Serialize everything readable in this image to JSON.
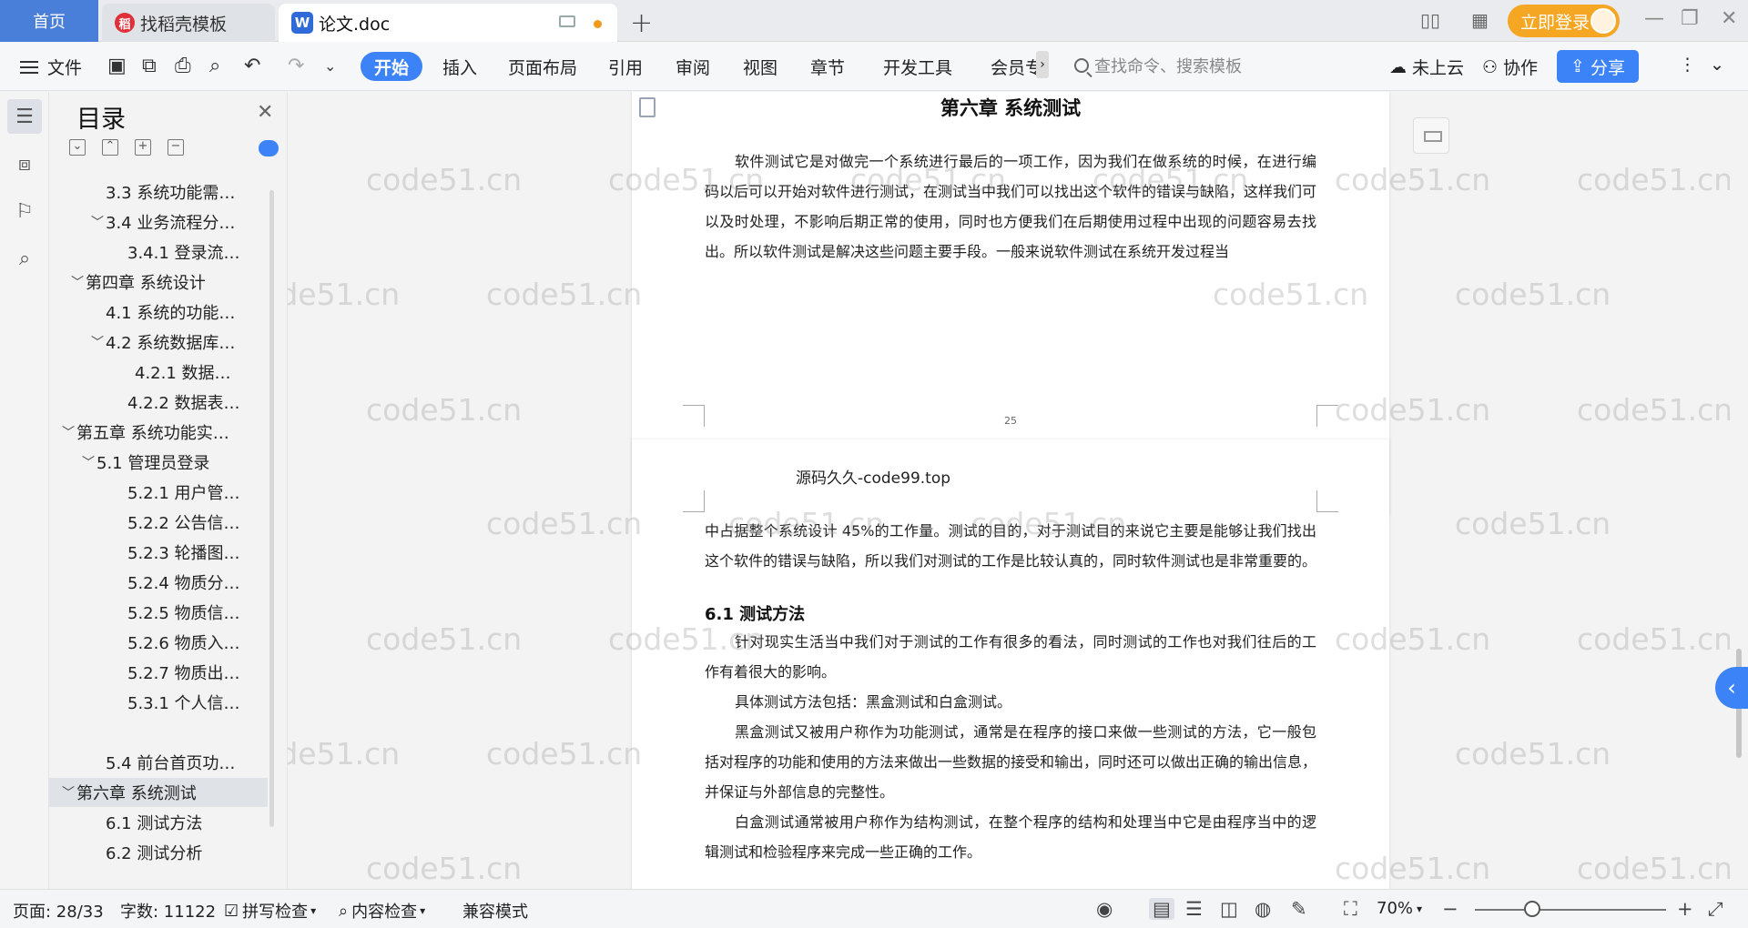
{
  "titlebar": {
    "home_tab": "首页",
    "docer_tab": "找稻壳模板",
    "doc_tab": "论文.doc",
    "login_label": "立即登录"
  },
  "ribbon": {
    "file_label": "文件",
    "tabs": [
      "开始",
      "插入",
      "页面布局",
      "引用",
      "审阅",
      "视图",
      "章节",
      "开发工具",
      "会员专"
    ],
    "active_tab": "开始",
    "search_placeholder": "查找命令、搜索模板",
    "cloud_label": "未上云",
    "collab_label": "协作",
    "share_label": "分享"
  },
  "toc": {
    "title": "目录",
    "items": [
      {
        "label": "3.3  系统功能需…",
        "caret": ""
      },
      {
        "label": "3.4  业务流程分…",
        "caret": "﹀"
      },
      {
        "label": "3.4.1 登录流…",
        "caret": ""
      },
      {
        "label": "第四章  系统设计",
        "caret": "﹀"
      },
      {
        "label": "4.1  系统的功能…",
        "caret": ""
      },
      {
        "label": "4.2  系统数据库…",
        "caret": "﹀"
      },
      {
        "label": "4.2.1    数据…",
        "caret": ""
      },
      {
        "label": "4.2.2    数据表…",
        "caret": ""
      },
      {
        "label": "第五章  系统功能实…",
        "caret": "﹀"
      },
      {
        "label": "5.1 管理员登录",
        "caret": "﹀"
      },
      {
        "label": "5.2.1  用户管…",
        "caret": ""
      },
      {
        "label": "5.2.2  公告信…",
        "caret": ""
      },
      {
        "label": "5.2.3 轮播图…",
        "caret": ""
      },
      {
        "label": "5.2.4  物质分…",
        "caret": ""
      },
      {
        "label": "5.2.5  物质信…",
        "caret": ""
      },
      {
        "label": "5.2.6  物质入…",
        "caret": ""
      },
      {
        "label": "5.2.7  物质出…",
        "caret": ""
      },
      {
        "label": "5.3.1 个人信…",
        "caret": ""
      },
      {
        "label": "",
        "caret": ""
      },
      {
        "label": "5.4 前台首页功…",
        "caret": ""
      },
      {
        "label": "第六章  系统测试",
        "caret": "﹀"
      },
      {
        "label": "6.1  测试方法",
        "caret": ""
      },
      {
        "label": "6.2  测试分析",
        "caret": ""
      }
    ]
  },
  "document": {
    "watermark": "code51.cn",
    "page1": {
      "chapter_title": "第六章  系统测试",
      "paragraph": "软件测试它是对做完一个系统进行最后的一项工作，因为我们在做系统的时候，在进行编码以后可以开始对软件进行测试，在测试当中我们可以找出这个软件的错误与缺陷，这样我们可以及时处理，不影响后期正常的使用，同时也方便我们在后期使用过程中出现的问题容易去找出。所以软件测试是解决这些问题主要手段。一般来说软件测试在系统开发过程当",
      "page_number": "25"
    },
    "page2": {
      "header": "源码久久-code99.top",
      "para1": "中占据整个系统设计 45%的工作量。测试的目的，对于测试目的来说它主要是能够让我们找出这个软件的错误与缺陷，所以我们对测试的工作是比较认真的，同时软件测试也是非常重要的。",
      "section_title": "6.1  测试方法",
      "para2": "针对现实生活当中我们对于测试的工作有很多的看法，同时测试的工作也对我们往后的工作有着很大的影响。",
      "para3": "具体测试方法包括：黑盒测试和白盒测试。",
      "para4": "黑盒测试又被用户称作为功能测试，通常是在程序的接口来做一些测试的方法，它一般包括对程序的功能和使用的方法来做出一些数据的接受和输出，同时还可以做出正确的输出信息，并保证与外部信息的完整性。",
      "para5": "白盒测试通常被用户称作为结构测试，在整个程序的结构和处理当中它是由程序当中的逻辑测试和检验程序来完成一些正确的工作。"
    }
  },
  "statusbar": {
    "page_info": "页面: 28/33",
    "word_count": "字数: 11122",
    "spell_check": "拼写检查",
    "content_check": "内容检查",
    "compat_mode": "兼容模式",
    "zoom": "70%"
  }
}
